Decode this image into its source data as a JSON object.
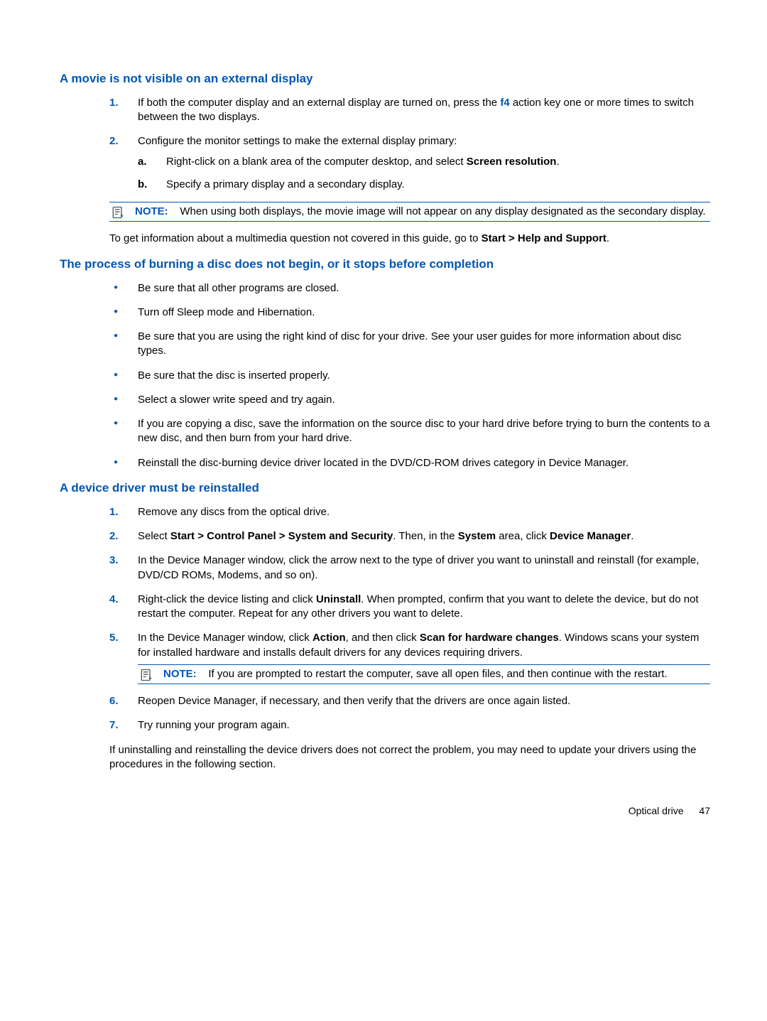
{
  "sec1": {
    "heading": "A movie is not visible on an external display",
    "step1_pre": "If both the computer display and an external display are turned on, press the ",
    "step1_key": "f4",
    "step1_post": " action key one or more times to switch between the two displays.",
    "step2": "Configure the monitor settings to make the external display primary:",
    "step2a_pre": "Right-click on a blank area of the computer desktop, and select ",
    "step2a_bold": "Screen resolution",
    "step2a_post": ".",
    "step2b": "Specify a primary display and a secondary display.",
    "note_label": "NOTE:",
    "note_body": "When using both displays, the movie image will not appear on any display designated as the secondary display.",
    "tail_pre": "To get information about a multimedia question not covered in this guide, go to ",
    "tail_bold": "Start > Help and Support",
    "tail_post": "."
  },
  "sec2": {
    "heading": "The process of burning a disc does not begin, or it stops before completion",
    "b1": "Be sure that all other programs are closed.",
    "b2": "Turn off Sleep mode and Hibernation.",
    "b3": "Be sure that you are using the right kind of disc for your drive. See your user guides for more information about disc types.",
    "b4": "Be sure that the disc is inserted properly.",
    "b5": "Select a slower write speed and try again.",
    "b6": "If you are copying a disc, save the information on the source disc to your hard drive before trying to burn the contents to a new disc, and then burn from your hard drive.",
    "b7": "Reinstall the disc-burning device driver located in the DVD/CD-ROM drives category in Device Manager."
  },
  "sec3": {
    "heading": "A device driver must be reinstalled",
    "s1": "Remove any discs from the optical drive.",
    "s2_a": "Select ",
    "s2_b1": "Start > Control Panel > System and Security",
    "s2_b": ". Then, in the ",
    "s2_b2": "System",
    "s2_c": " area, click ",
    "s2_b3": "Device Manager",
    "s2_d": ".",
    "s3": "In the Device Manager window, click the arrow next to the type of driver you want to uninstall and reinstall (for example, DVD/CD ROMs, Modems, and so on).",
    "s4_a": "Right-click the device listing and click ",
    "s4_b1": "Uninstall",
    "s4_b": ". When prompted, confirm that you want to delete the device, but do not restart the computer. Repeat for any other drivers you want to delete.",
    "s5_a": "In the Device Manager window, click ",
    "s5_b1": "Action",
    "s5_b": ", and then click ",
    "s5_b2": "Scan for hardware changes",
    "s5_c": ". Windows scans your system for installed hardware and installs default drivers for any devices requiring drivers.",
    "note_label": "NOTE:",
    "note_body": "If you are prompted to restart the computer, save all open files, and then continue with the restart.",
    "s6": "Reopen Device Manager, if necessary, and then verify that the drivers are once again listed.",
    "s7": "Try running your program again.",
    "tail": "If uninstalling and reinstalling the device drivers does not correct the problem, you may need to update your drivers using the procedures in the following section."
  },
  "footer": {
    "section": "Optical drive",
    "page": "47"
  }
}
